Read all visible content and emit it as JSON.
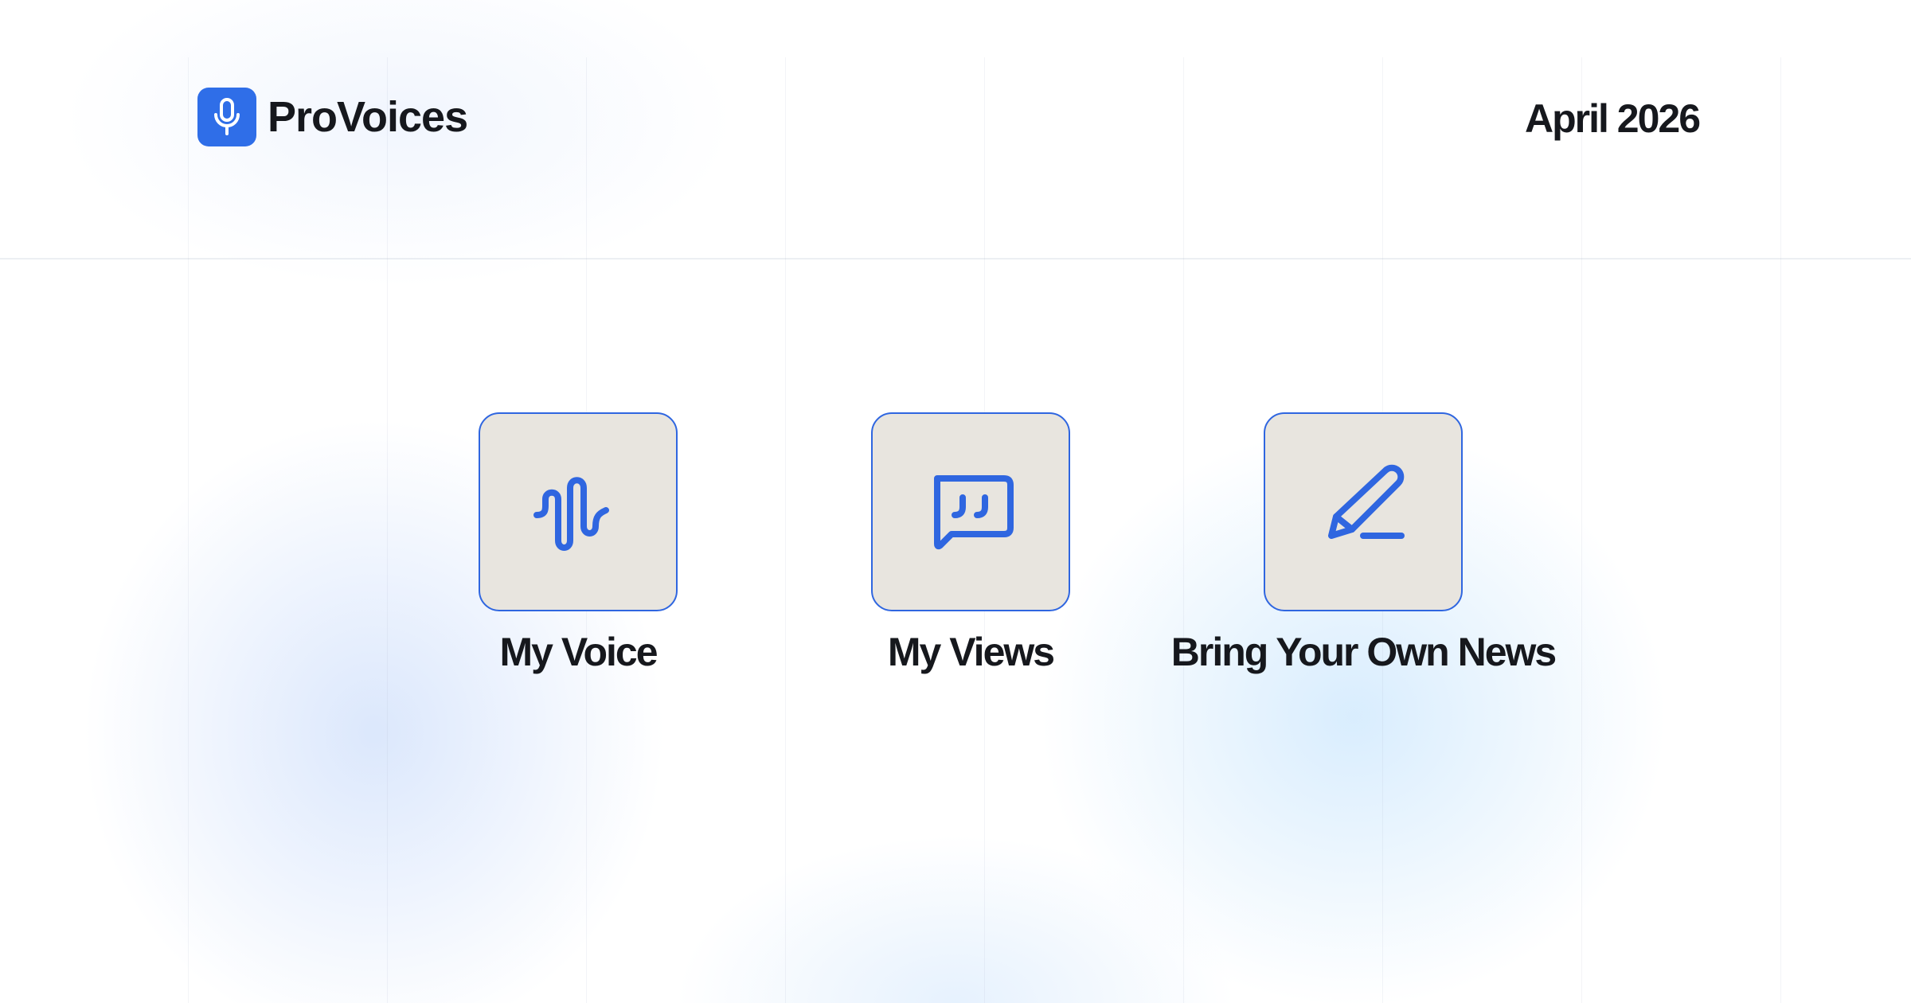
{
  "brand": {
    "name": "ProVoices",
    "logo_icon": "microphone-icon",
    "accent_color": "#2f6ee8"
  },
  "header": {
    "date": "April 2026"
  },
  "features": [
    {
      "label": "My Voice",
      "icon": "waveform-icon"
    },
    {
      "label": "My Views",
      "icon": "quote-chat-icon"
    },
    {
      "label": "Bring Your Own News",
      "icon": "pencil-icon"
    }
  ],
  "colors": {
    "tile_background": "#e8e5df",
    "tile_border": "#2f66e0",
    "text": "#16181d"
  }
}
